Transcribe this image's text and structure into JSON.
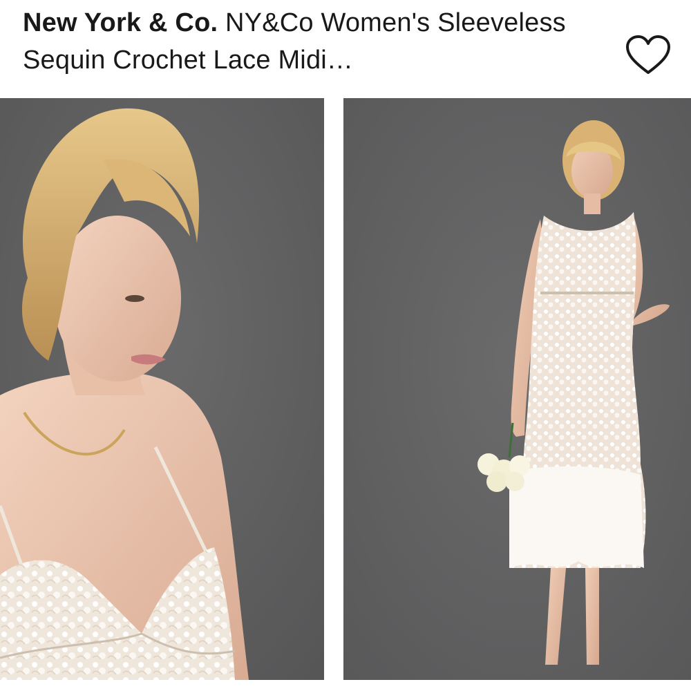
{
  "listing": {
    "brand": "New York & Co.",
    "title_rest": "NY&Co Women's Sleeveless Sequin Crochet Lace Midi…"
  },
  "icons": {
    "favorite": "heart-outline-icon"
  },
  "colors": {
    "background": "#ffffff",
    "title_text": "#191919",
    "photo_backdrop": "#5e5e5f",
    "dress": "#f2ece6"
  }
}
